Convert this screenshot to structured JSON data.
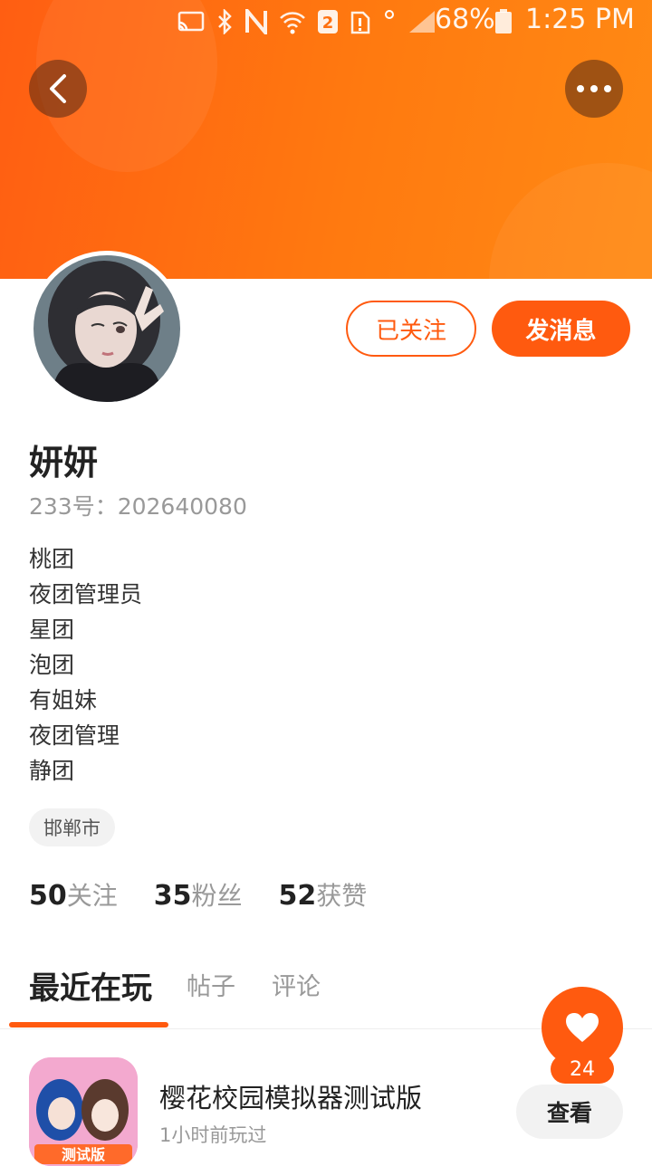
{
  "status_bar": {
    "battery": "68%",
    "time": "1:25 PM",
    "icons": [
      "cast-icon",
      "bluetooth-icon",
      "nfc-icon",
      "wifi-icon",
      "sim2-icon",
      "sim-alert-icon",
      "signal-icon",
      "battery-icon"
    ]
  },
  "header": {
    "back_icon": "chevron-left-icon",
    "more_icon": "more-dots-icon",
    "gradient_colors": [
      "#ff5e12",
      "#ff8a14"
    ]
  },
  "actions": {
    "follow_label": "已关注",
    "message_label": "发消息",
    "accent": "#ff5a0f"
  },
  "profile": {
    "name": "妍妍",
    "id_line": "233号：202640080",
    "bio": [
      "桃团",
      "夜团管理员",
      "星团",
      "泡团",
      "有姐妹",
      "夜团管理",
      "静团"
    ],
    "location": "邯郸市"
  },
  "stats": {
    "following_count": "50",
    "following_label": "关注",
    "fans_count": "35",
    "fans_label": "粉丝",
    "likes_count": "52",
    "likes_label": "获赞"
  },
  "tabs": [
    "最近在玩",
    "帖子",
    "评论"
  ],
  "fab": {
    "icon": "heart-icon",
    "count": "24"
  },
  "recent_game": {
    "title": "樱花校园模拟器测试版",
    "subtitle": "1小时前玩过",
    "icon_badge": "测试版",
    "view_label": "查看"
  }
}
